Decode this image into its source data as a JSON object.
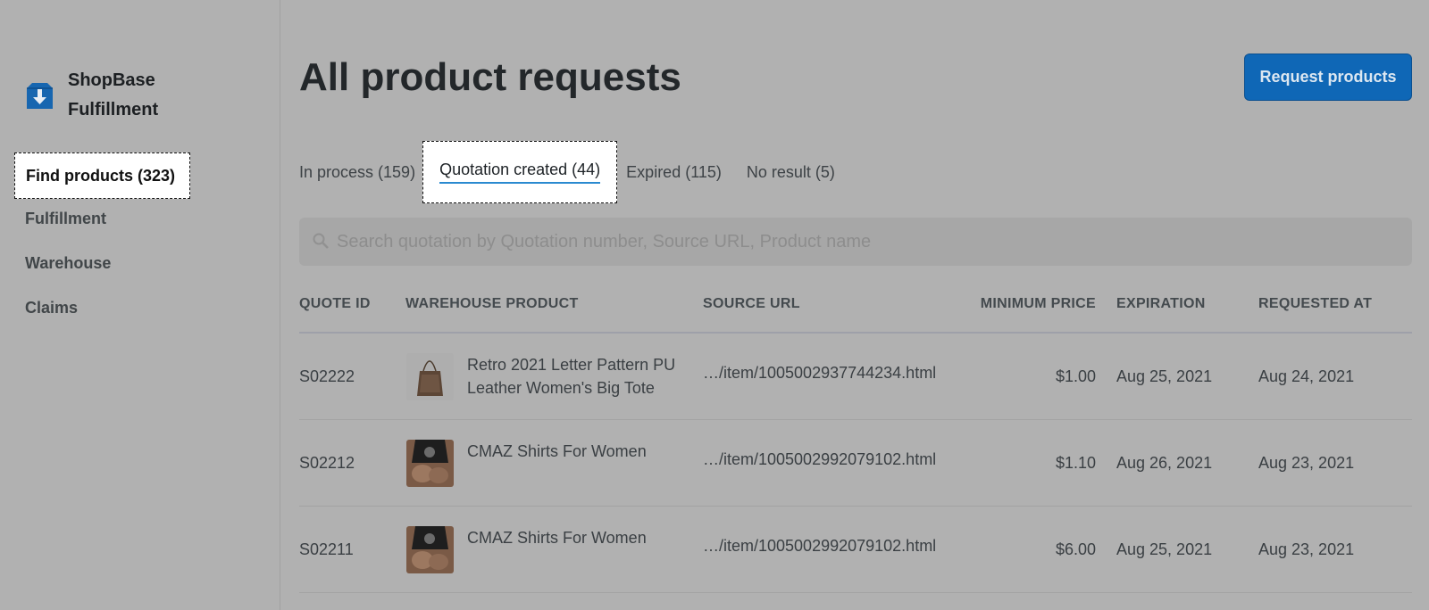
{
  "sidebar": {
    "brand_line1": "ShopBase",
    "brand_line2": "Fulfillment",
    "items": [
      {
        "label": "Find products (323)"
      },
      {
        "label": "Fulfillment"
      },
      {
        "label": "Warehouse"
      },
      {
        "label": "Claims"
      }
    ]
  },
  "header": {
    "title": "All product requests",
    "request_button": "Request products"
  },
  "tabs": [
    {
      "label": "In process (159)"
    },
    {
      "label": "Quotation created (44)"
    },
    {
      "label": "Expired (115)"
    },
    {
      "label": "No result (5)"
    }
  ],
  "search": {
    "placeholder": "Search quotation by Quotation number, Source URL, Product name"
  },
  "table": {
    "columns": [
      "QUOTE ID",
      "WAREHOUSE PRODUCT",
      "SOURCE URL",
      "MINIMUM PRICE",
      "EXPIRATION",
      "REQUESTED AT"
    ],
    "rows": [
      {
        "id": "S02222",
        "product": "Retro 2021 Letter Pattern PU Leather Women's Big Tote",
        "url": "…/item/1005002937744234.html",
        "price": "$1.00",
        "expiration": "Aug 25, 2021",
        "requested": "Aug 24, 2021",
        "thumb": "tote-bag-image"
      },
      {
        "id": "S02212",
        "product": "CMAZ Shirts For Women",
        "url": "…/item/1005002992079102.html",
        "price": "$1.10",
        "expiration": "Aug 26, 2021",
        "requested": "Aug 23, 2021",
        "thumb": "shirt-image"
      },
      {
        "id": "S02211",
        "product": "CMAZ Shirts For Women",
        "url": "…/item/1005002992079102.html",
        "price": "$6.00",
        "expiration": "Aug 25, 2021",
        "requested": "Aug 23, 2021",
        "thumb": "shirt-image"
      }
    ]
  },
  "colors": {
    "accent": "#0f67b6",
    "tab_underline": "#2a8ad0",
    "background": "#b1b1b1"
  }
}
